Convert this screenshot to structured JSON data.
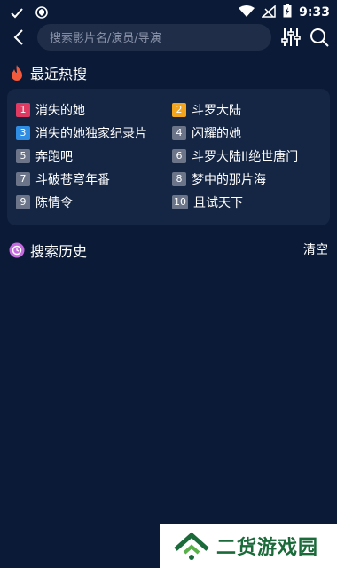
{
  "status_bar": {
    "time": "9:33"
  },
  "search": {
    "placeholder": "搜索影片名/演员/导演"
  },
  "hot": {
    "title": "最近热搜",
    "items": [
      {
        "rank": "1",
        "label": "消失的她",
        "color": "#e03a63"
      },
      {
        "rank": "2",
        "label": "斗罗大陆",
        "color": "#f3a51d"
      },
      {
        "rank": "3",
        "label": "消失的她独家纪录片",
        "color": "#2f8de4"
      },
      {
        "rank": "4",
        "label": "闪耀的她",
        "color": "#6b7488"
      },
      {
        "rank": "5",
        "label": "奔跑吧",
        "color": "#6b7488"
      },
      {
        "rank": "6",
        "label": "斗罗大陆II绝世唐门",
        "color": "#6b7488"
      },
      {
        "rank": "7",
        "label": "斗破苍穹年番",
        "color": "#6b7488"
      },
      {
        "rank": "8",
        "label": "梦中的那片海",
        "color": "#6b7488"
      },
      {
        "rank": "9",
        "label": "陈情令",
        "color": "#6b7488"
      },
      {
        "rank": "10",
        "label": "且试天下",
        "color": "#6b7488"
      }
    ]
  },
  "history": {
    "title": "搜索历史",
    "clear_label": "清空"
  },
  "watermark": {
    "text": "二货游戏园"
  }
}
